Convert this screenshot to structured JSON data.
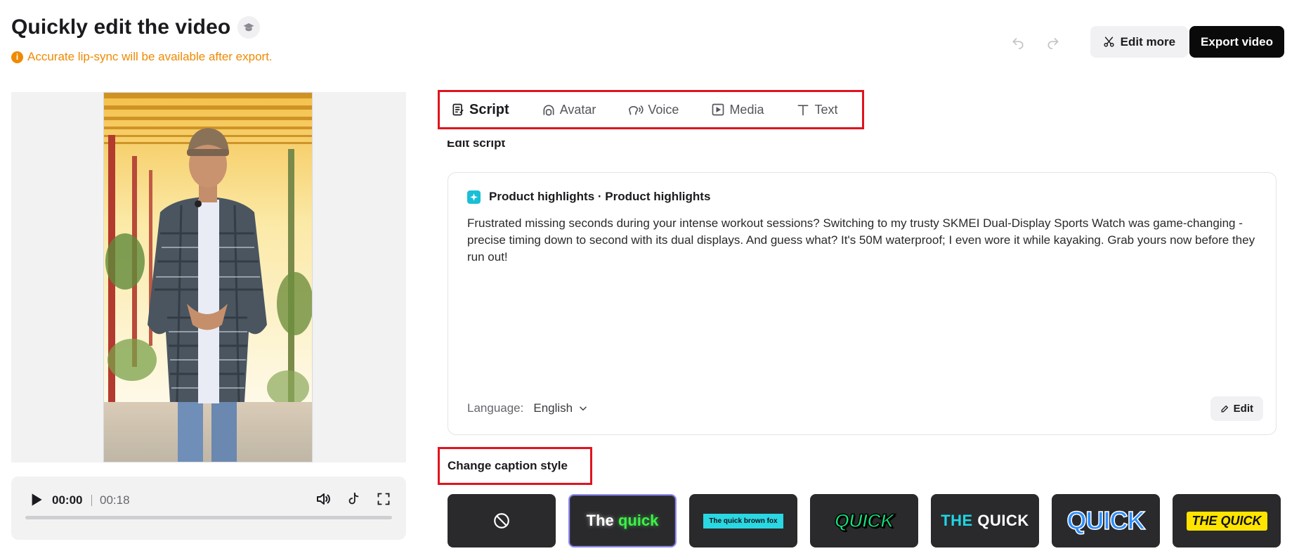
{
  "header": {
    "title": "Quickly edit the video",
    "notice": "Accurate lip-sync will be available after export.",
    "edit_more_label": "Edit more",
    "export_label": "Export video"
  },
  "player": {
    "current_time": "00:00",
    "total_time": "00:18",
    "progress": 0
  },
  "tabs": [
    {
      "label": "Script",
      "icon": "script-icon",
      "active": true
    },
    {
      "label": "Avatar",
      "icon": "avatar-icon",
      "active": false
    },
    {
      "label": "Voice",
      "icon": "voice-icon",
      "active": false
    },
    {
      "label": "Media",
      "icon": "media-icon",
      "active": false
    },
    {
      "label": "Text",
      "icon": "text-icon",
      "active": false
    }
  ],
  "section_heading": "Edit script",
  "script": {
    "title": "Product highlights · Product highlights",
    "body": "Frustrated missing seconds during your intense workout sessions? Switching to my trusty SKMEI Dual-Display Sports Watch was game-changing - precise timing down to second with its dual displays. And guess what? It's 50M waterproof; I even wore it while kayaking. Grab yours now before they run out!",
    "language_label": "Language:",
    "language_value": "English",
    "edit_label": "Edit"
  },
  "captions": {
    "label": "Change caption style",
    "styles": [
      {
        "kind": "none",
        "text": ""
      },
      {
        "kind": "glow",
        "text_a": "The",
        "text_b": "quick",
        "selected": true
      },
      {
        "kind": "box",
        "text": "The quick brown fox"
      },
      {
        "kind": "outline",
        "text": "QUICK"
      },
      {
        "kind": "duo",
        "text_a": "THE",
        "text_b": "QUICK"
      },
      {
        "kind": "stroke",
        "text": "QUICK"
      },
      {
        "kind": "highlight",
        "text": "THE QUICK"
      }
    ]
  },
  "colors": {
    "accent_orange": "#ef8a00",
    "highlight_red": "#e0141e",
    "export_bg": "#0a0a0a"
  }
}
